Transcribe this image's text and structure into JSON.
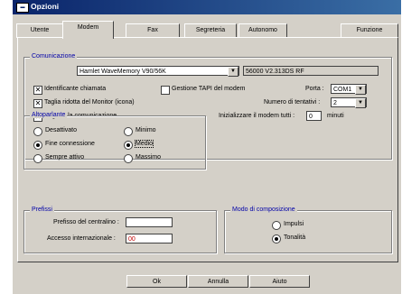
{
  "window": {
    "title": "Opzioni"
  },
  "tabs": [
    "Utente",
    "Modem",
    "Fax",
    "Segreteria",
    "Autonomo",
    "Funzione"
  ],
  "comunicazione": {
    "legend": "Comunicazione",
    "modem_select": "Hamlet WaveMemory V90/56K",
    "modem_info": "56000 V2.313DS RF",
    "check_identificante": "Identificante chiamata",
    "check_tapi": "Gestione TAPI del modem",
    "check_taglia": "Taglia ridotta del Monitor (icona)",
    "check_seguire": "Seguire la comunicazione",
    "porta_label": "Porta :",
    "porta_value": "COM1",
    "tentativi_label": "Numero di tentativi :",
    "tentativi_value": "2",
    "init_label": "Inizializzare il modem tutti :",
    "init_value": "0",
    "init_unit": "minuti"
  },
  "altoparlante": {
    "legend": "Altoparlante",
    "disattivato": "Desattivato",
    "fine": "Fine connessione",
    "sempre": "Sempre attivo",
    "minimo": "Minimo",
    "medio": "Medio",
    "massimo": "Massimo"
  },
  "prefissi": {
    "legend": "Prefissi",
    "centralino_label": "Prefisso del centralino :",
    "centralino_value": "",
    "internazionale_label": "Accesso internazionale :",
    "internazionale_value": "00"
  },
  "composizione": {
    "legend": "Modo di composizione",
    "impulsi": "Impulsi",
    "tonalita": "Tonalità"
  },
  "buttons": {
    "ok": "Ok",
    "annulla": "Annulla",
    "aiuto": "Aiuto"
  }
}
